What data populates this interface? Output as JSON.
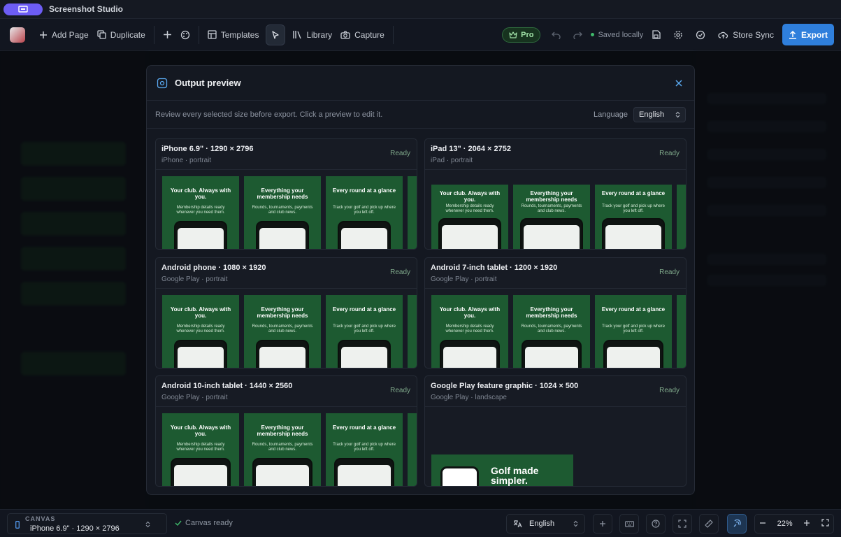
{
  "app": {
    "title": "Screenshot Studio"
  },
  "toolbar": {
    "add_page": "Add Page",
    "duplicate": "Duplicate",
    "templates": "Templates",
    "library": "Library",
    "capture": "Capture",
    "pro": "Pro",
    "saved": "Saved locally",
    "store_sync": "Store Sync",
    "export": "Export"
  },
  "modal": {
    "title": "Output preview",
    "description": "Review every selected size before export. Click a preview to edit it.",
    "language_label": "Language",
    "language_value": "English",
    "cards": [
      {
        "title": "iPhone 6.9\" · 1290 × 2796",
        "subtitle": "iPhone · portrait",
        "status": "Ready"
      },
      {
        "title": "iPad 13\" · 2064 × 2752",
        "subtitle": "iPad · portrait",
        "status": "Ready"
      },
      {
        "title": "Android phone · 1080 × 1920",
        "subtitle": "Google Play · portrait",
        "status": "Ready"
      },
      {
        "title": "Android 7-inch tablet · 1200 × 1920",
        "subtitle": "Google Play · portrait",
        "status": "Ready"
      },
      {
        "title": "Android 10-inch tablet · 1440 × 2560",
        "subtitle": "Google Play · portrait",
        "status": "Ready"
      },
      {
        "title": "Google Play feature graphic · 1024 × 500",
        "subtitle": "Google Play · landscape",
        "status": "Ready"
      }
    ],
    "shots": [
      {
        "heading": "Your club. Always with you.",
        "sub": "Membership details ready whenever you need them."
      },
      {
        "heading": "Everything your membership needs",
        "sub": "Rounds, tournaments, payments and club news."
      },
      {
        "heading": "Every round at a glance",
        "sub": "Track your golf and pick up where you left off."
      }
    ],
    "feature_graphic_text": "Golf made simpler."
  },
  "bottombar": {
    "canvas_label": "CANVAS",
    "canvas_value": "iPhone 6.9\" · 1290 × 2796",
    "status": "Canvas ready",
    "language": "English",
    "zoom": "22%"
  },
  "colors": {
    "accent": "#2f7fdc",
    "pro": "#9fe0a6",
    "shot_bg": "#1d5a31",
    "app_pill": "#6d5df5"
  }
}
